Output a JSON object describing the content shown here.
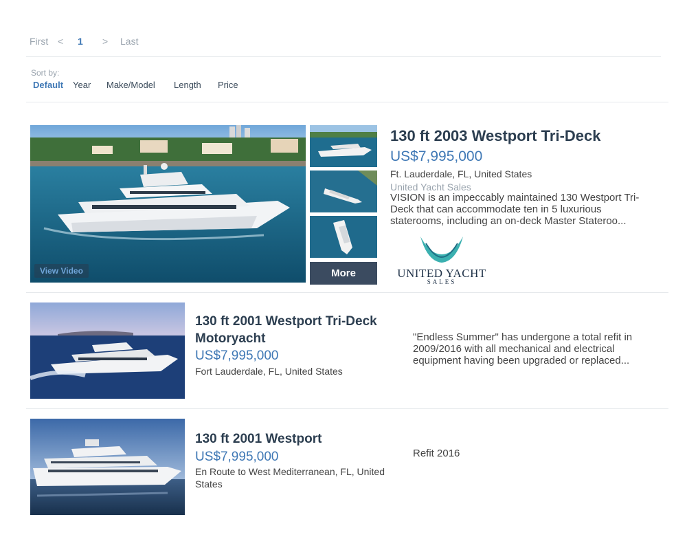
{
  "pagination": {
    "first": "First",
    "prev": "<",
    "current": "1",
    "next": ">",
    "last": "Last"
  },
  "sort": {
    "label": "Sort by:",
    "options": [
      "Default",
      "Year",
      "Make/Model",
      "Length",
      "Price"
    ],
    "active": "Default"
  },
  "featured": {
    "title": "130 ft 2003 Westport Tri-Deck",
    "price": "US$7,995,000",
    "location": "Ft. Lauderdale, FL, United States",
    "broker": "United Yacht Sales",
    "description": "VISION is an impeccably maintained 130 Westport Tri-Deck that can accommodate ten in 5 luxurious staterooms, including an on-deck Master Stateroo...",
    "video_label": "View Video",
    "more_label": "More",
    "logo": {
      "name": "UNITED YACHT",
      "sub": "SALES",
      "color": "#3bb0b0"
    }
  },
  "listings": [
    {
      "title": "130 ft 2001 Westport Tri-Deck Motoryacht",
      "price": "US$7,995,000",
      "location": "Fort Lauderdale, FL, United States",
      "description": "\"Endless Summer\" has undergone a total refit in 2009/2016 with all mechanical and electrical equipment having been upgraded or replaced..."
    },
    {
      "title": "130 ft 2001 Westport",
      "price": "US$7,995,000",
      "location": "En Route to West Mediterranean, FL, United States",
      "description": "Refit 2016"
    }
  ],
  "colors": {
    "accent": "#3f78b5",
    "button": "#3b4b60",
    "text": "#2c3e50"
  }
}
